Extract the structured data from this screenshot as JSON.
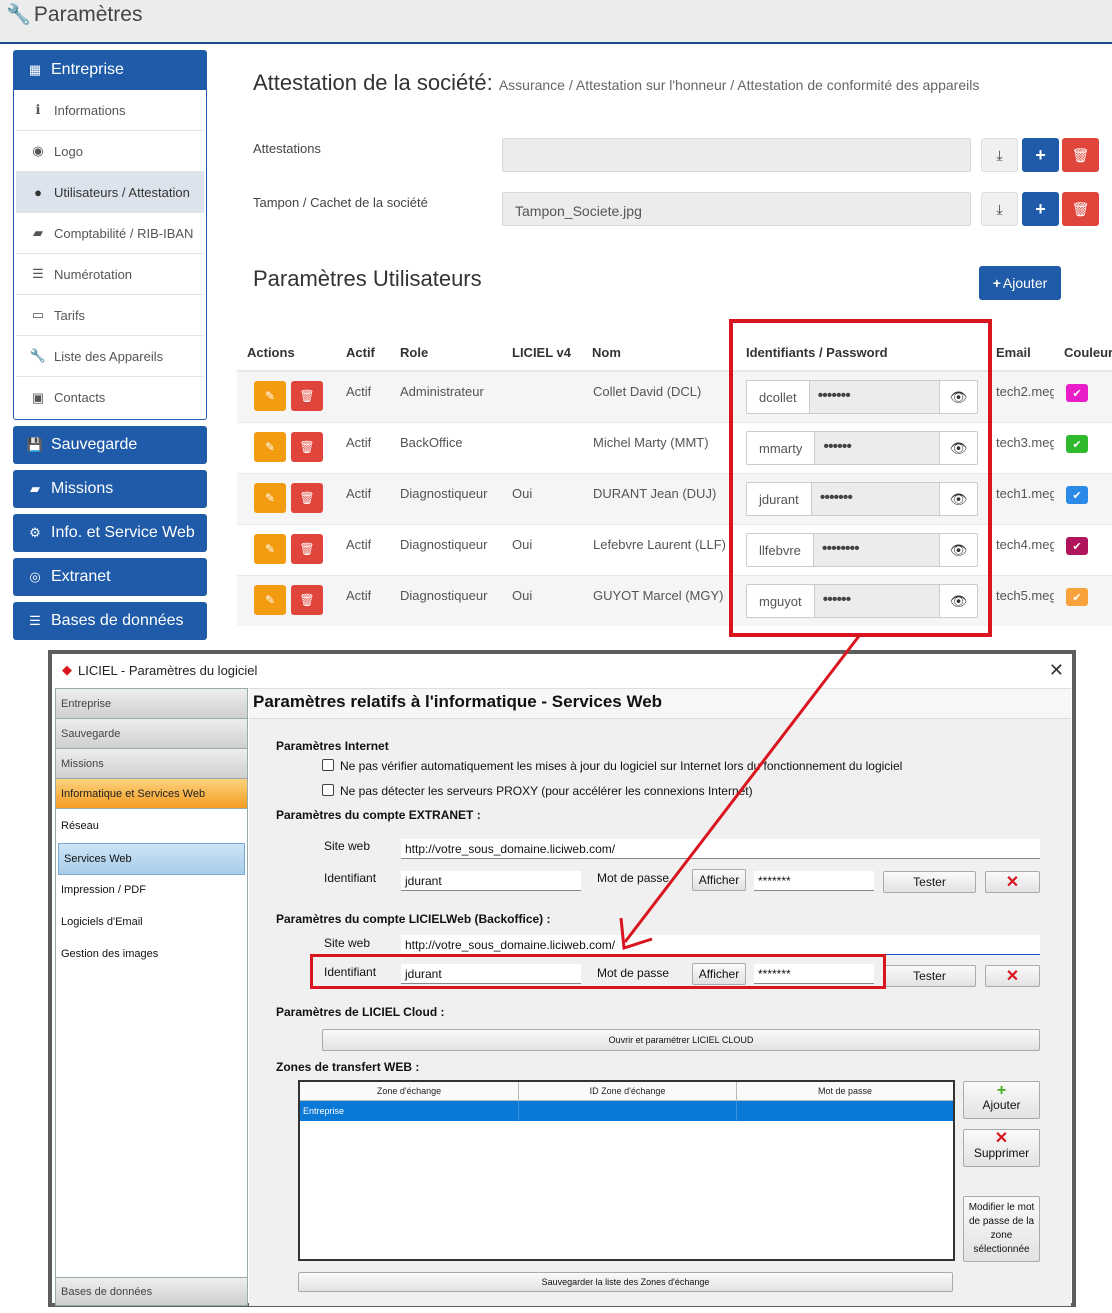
{
  "app": {
    "title": "Paramètres"
  },
  "sidebar": {
    "entreprise": "Entreprise",
    "items": [
      {
        "label": "Informations",
        "icon": "info-icon"
      },
      {
        "label": "Logo",
        "icon": "logo-icon"
      },
      {
        "label": "Utilisateurs / Attestation",
        "icon": "user-icon"
      },
      {
        "label": "Comptabilité / RIB-IBAN",
        "icon": "book-icon"
      },
      {
        "label": "Numérotation",
        "icon": "list-numbered-icon"
      },
      {
        "label": "Tarifs",
        "icon": "money-icon"
      },
      {
        "label": "Liste des Appareils",
        "icon": "wrench-icon"
      },
      {
        "label": "Contacts",
        "icon": "contact-icon"
      }
    ],
    "sections": [
      "Sauvegarde",
      "Missions",
      "Info. et Service Web",
      "Extranet",
      "Bases de données"
    ]
  },
  "attestation": {
    "title": "Attestation de la société:",
    "breadcrumb": "Assurance / Attestation sur l'honneur / Attestation de conformité des appareils",
    "attestations_label": "Attestations",
    "attestations_value": "",
    "tampon_label": "Tampon / Cachet de la société",
    "tampon_value": "Tampon_Societe.jpg"
  },
  "users": {
    "title": "Paramètres Utilisateurs",
    "add_label": "Ajouter",
    "columns": [
      "Actions",
      "Actif",
      "Role",
      "LICIEL v4",
      "Nom",
      "Identifiants / Password",
      "Email",
      "Couleur"
    ],
    "rows": [
      {
        "actif": "Actif",
        "role": "Administrateur",
        "v4": "",
        "nom": "Collet David (DCL)",
        "login": "dcollet",
        "pwd": "•••••••",
        "email": "tech2.meg",
        "color": "#e91ec8"
      },
      {
        "actif": "Actif",
        "role": "BackOffice",
        "v4": "",
        "nom": "Michel Marty (MMT)",
        "login": "mmarty",
        "pwd": "••••••",
        "email": "tech3.meg",
        "color": "#2eb82e"
      },
      {
        "actif": "Actif",
        "role": "Diagnostiqueur",
        "v4": "Oui",
        "nom": "DURANT Jean (DUJ)",
        "login": "jdurant",
        "pwd": "•••••••",
        "email": "tech1.meg",
        "color": "#2b8ae8"
      },
      {
        "actif": "Actif",
        "role": "Diagnostiqueur",
        "v4": "Oui",
        "nom": "Lefebvre Laurent (LLF)",
        "login": "llfebvre",
        "pwd": "••••••••",
        "email": "tech4.meg",
        "color": "#b0145a"
      },
      {
        "actif": "Actif",
        "role": "Diagnostiqueur",
        "v4": "Oui",
        "nom": "GUYOT Marcel (MGY)",
        "login": "mguyot",
        "pwd": "••••••",
        "email": "tech5.meg",
        "color": "#f7a23a"
      }
    ]
  },
  "dialog": {
    "title": "LICIEL - Paramètres du logiciel",
    "tabs_top": [
      "Entreprise",
      "Sauvegarde",
      "Missions"
    ],
    "active_tab": "Informatique et Services Web",
    "subitems": [
      "Réseau",
      "Services Web",
      "Impression / PDF",
      "Logiciels d'Email",
      "Gestion des images"
    ],
    "bottom_tab": "Bases de données",
    "header": "Paramètres relatifs à l'informatique - Services Web",
    "internet": {
      "title": "Paramètres Internet",
      "check1": "Ne pas vérifier automatiquement les mises à jour du logiciel sur Internet lors du fonctionnement du logiciel",
      "check2": "Ne pas détecter les serveurs PROXY (pour accélérer les connexions Internet)"
    },
    "extranet": {
      "title": "Paramètres du compte EXTRANET :",
      "site_label": "Site web",
      "site_value": "http://votre_sous_domaine.liciweb.com/",
      "id_label": "Identifiant",
      "id_value": "jdurant",
      "pwd_label": "Mot de passe",
      "show_label": "Afficher",
      "pwd_value": "*******",
      "test_label": "Tester"
    },
    "licielweb": {
      "title": "Paramètres du compte LICIELWeb (Backoffice) :",
      "site_label": "Site web",
      "site_value": "http://votre_sous_domaine.liciweb.com/",
      "id_label": "Identifiant",
      "id_value": "jdurant",
      "pwd_label": "Mot de passe",
      "show_label": "Afficher",
      "pwd_value": "*******",
      "test_label": "Tester"
    },
    "cloud": {
      "title": "Paramètres de LICIEL Cloud :",
      "button": "Ouvrir et paramétrer LICIEL CLOUD"
    },
    "zones": {
      "title": "Zones de transfert WEB :",
      "columns": [
        "Zone d'échange",
        "ID Zone d'échange",
        "Mot de passe"
      ],
      "rows": [
        {
          "zone": "Entreprise",
          "id": "",
          "pwd": ""
        }
      ],
      "add": "Ajouter",
      "delete": "Supprimer",
      "modify": "Modifier le mot de passe de la zone sélectionnée",
      "save": "Sauvegarder la liste des Zones d'échange"
    }
  }
}
